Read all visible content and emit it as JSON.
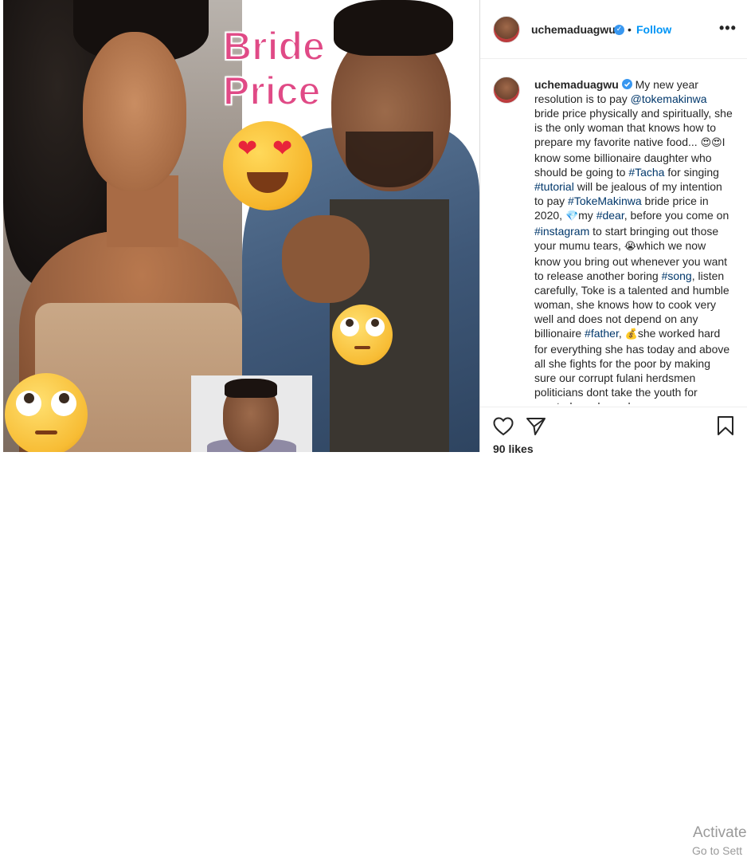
{
  "post": {
    "image_overlay_title_line1": "Bride",
    "image_overlay_title_line2": "Price"
  },
  "header": {
    "username": "uchemaduagwu",
    "separator": "•",
    "follow_label": "Follow",
    "more_label": "•••"
  },
  "caption": {
    "username": "uchemaduagwu",
    "segments": {
      "t1": " My new year resolution is to pay ",
      "m1": "@tokemakinwa",
      "t2": " bride price physically and spiritually, she is the only woman that knows how to prepare my favorite native food...",
      "e1": "😍😍",
      "t3": "I know some billionaire daughter who should be going to ",
      "h1": "#Tacha",
      "t4": " for singing ",
      "h2": "#tutorial",
      "t5": " will be jealous of my intention to pay ",
      "h3": "#TokeMakinwa",
      "t6": " bride price in 2020, ",
      "e2": "💎",
      "t7": "my ",
      "h4": "#dear",
      "t8": ", before you come on ",
      "h5": "#instagram",
      "t9": " to start bringing out those your mumu tears, ",
      "e3": "😭",
      "t10": "which we now know you bring out whenever you want to release another boring ",
      "h6": "#song",
      "t11": ", listen carefully, Toke is a talented and humble woman, she knows how to cook very well and does not depend on any billionaire ",
      "h7": "#father",
      "t12": ", ",
      "e4": "💰",
      "t13": "she worked hard for everything she has today and above all she fights for the poor by making sure our corrupt fulani herdsmen politicians dont take the youth for granted, madam, abeg"
    }
  },
  "actions": {
    "like_icon": "heart-icon",
    "share_icon": "send-icon",
    "save_icon": "bookmark-icon",
    "likes_text": "90 likes"
  },
  "watermark": {
    "line1": "Activate",
    "line2": "Go to Sett"
  },
  "colors": {
    "link": "#0095f6",
    "hashtag": "#00376b",
    "verified": "#3897f0",
    "overlay_title": "#e04a86"
  }
}
